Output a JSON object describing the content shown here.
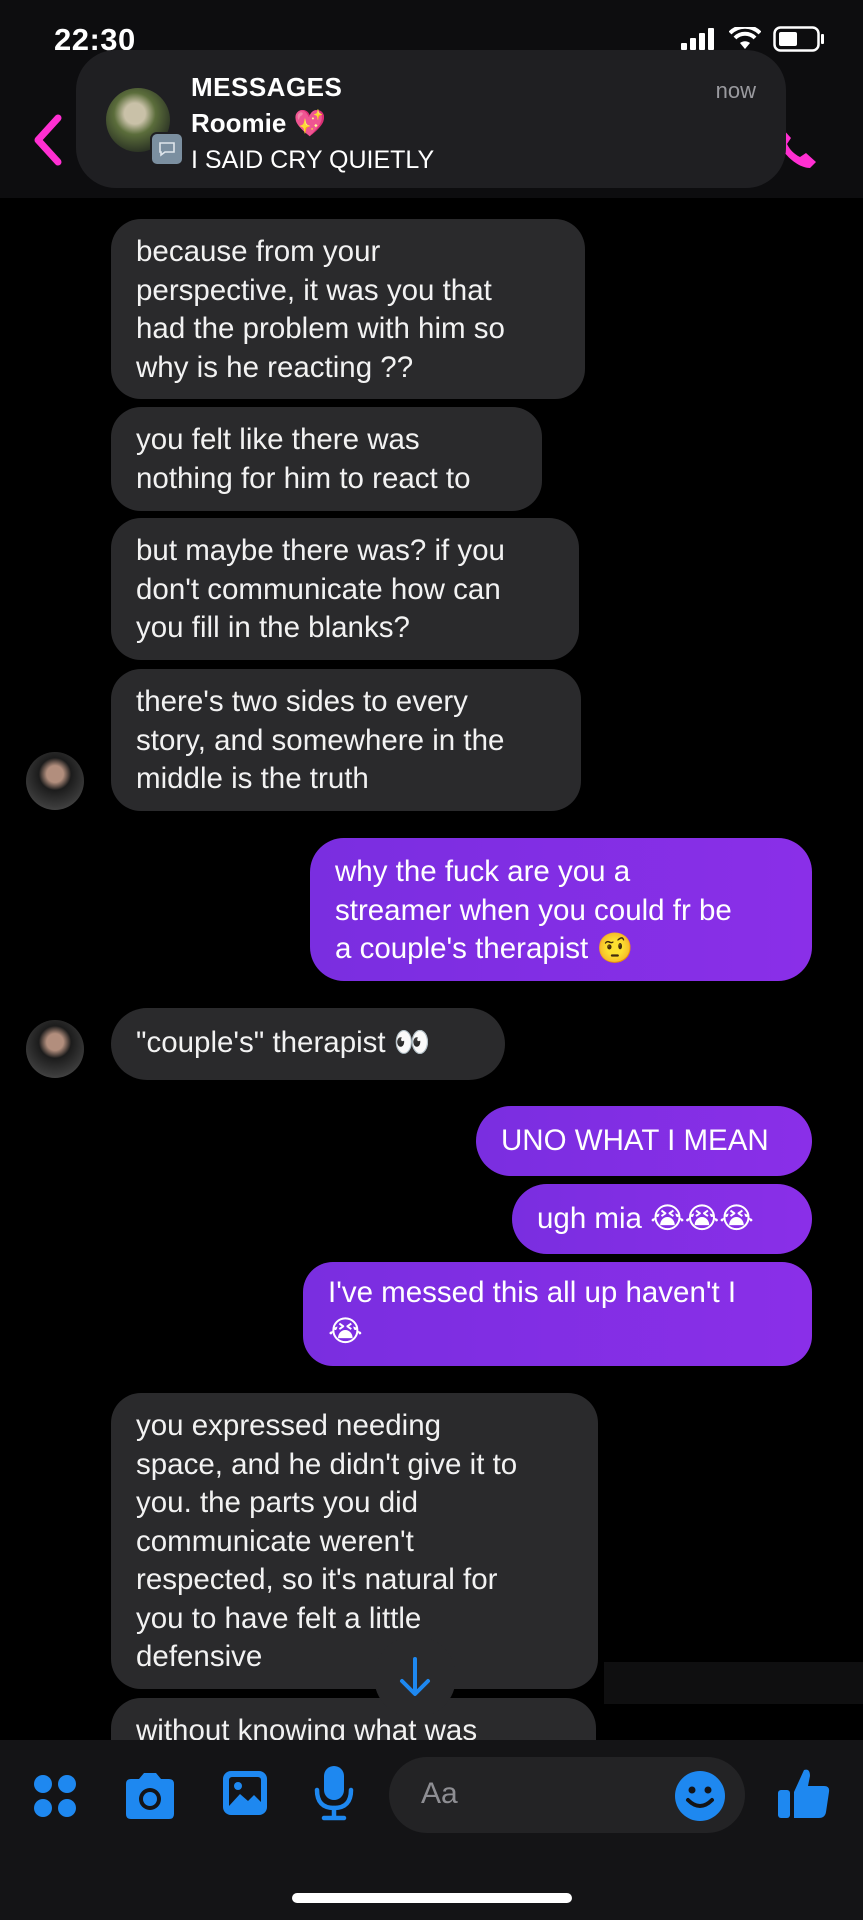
{
  "status_bar": {
    "time": "22:30"
  },
  "notification": {
    "app": "MESSAGES",
    "sender": "Roomie 💖",
    "text": "I SAID CRY QUIETLY",
    "time": "now"
  },
  "messages": [
    {
      "side": "in",
      "lines": [
        "because from your",
        "perspective, it was you that",
        "had the problem with him so",
        "why is he reacting ??"
      ]
    },
    {
      "side": "in",
      "lines": [
        "you felt like there was",
        "nothing for him to react to"
      ]
    },
    {
      "side": "in",
      "lines": [
        "but maybe there was? if you",
        "don't communicate how can",
        "you fill in the blanks?"
      ]
    },
    {
      "side": "in",
      "lines": [
        "there's two sides to every",
        "story, and somewhere in the",
        "middle is the truth"
      ]
    },
    {
      "side": "out",
      "lines": [
        "why the fuck are you a",
        "streamer when you could fr be",
        "a couple's therapist 🤨"
      ]
    },
    {
      "side": "in",
      "lines": [
        "\"couple's\" therapist 👀"
      ]
    },
    {
      "side": "out",
      "lines": [
        "UNO WHAT I MEAN"
      ]
    },
    {
      "side": "out",
      "lines": [
        "ugh mia 😭😭😭"
      ]
    },
    {
      "side": "out",
      "lines": [
        "I've messed this all up haven't I",
        "😭"
      ]
    },
    {
      "side": "in",
      "lines": [
        "you expressed needing",
        "space, and he didn't give it to",
        "you. the parts you did",
        "communicate weren't",
        "respected, so it's natural for",
        "you to have felt a little",
        "defensive"
      ]
    },
    {
      "side": "in",
      "lines": [
        "without knowing what was"
      ]
    }
  ],
  "composer": {
    "placeholder": "Aa"
  },
  "icons": {
    "back": "chevron-left-icon",
    "call": "phone-icon",
    "menu": "four-dots-icon",
    "camera": "camera-icon",
    "gallery": "image-icon",
    "mic": "microphone-icon",
    "emoji": "smiley-icon",
    "like": "thumbs-up-icon",
    "scroll": "arrow-down-icon"
  },
  "colors": {
    "accent_pink": "#ff2fd2",
    "accent_blue": "#1e88f0",
    "outgoing_bubble": "#8a2fe8",
    "incoming_bubble": "#2a2a2c"
  }
}
